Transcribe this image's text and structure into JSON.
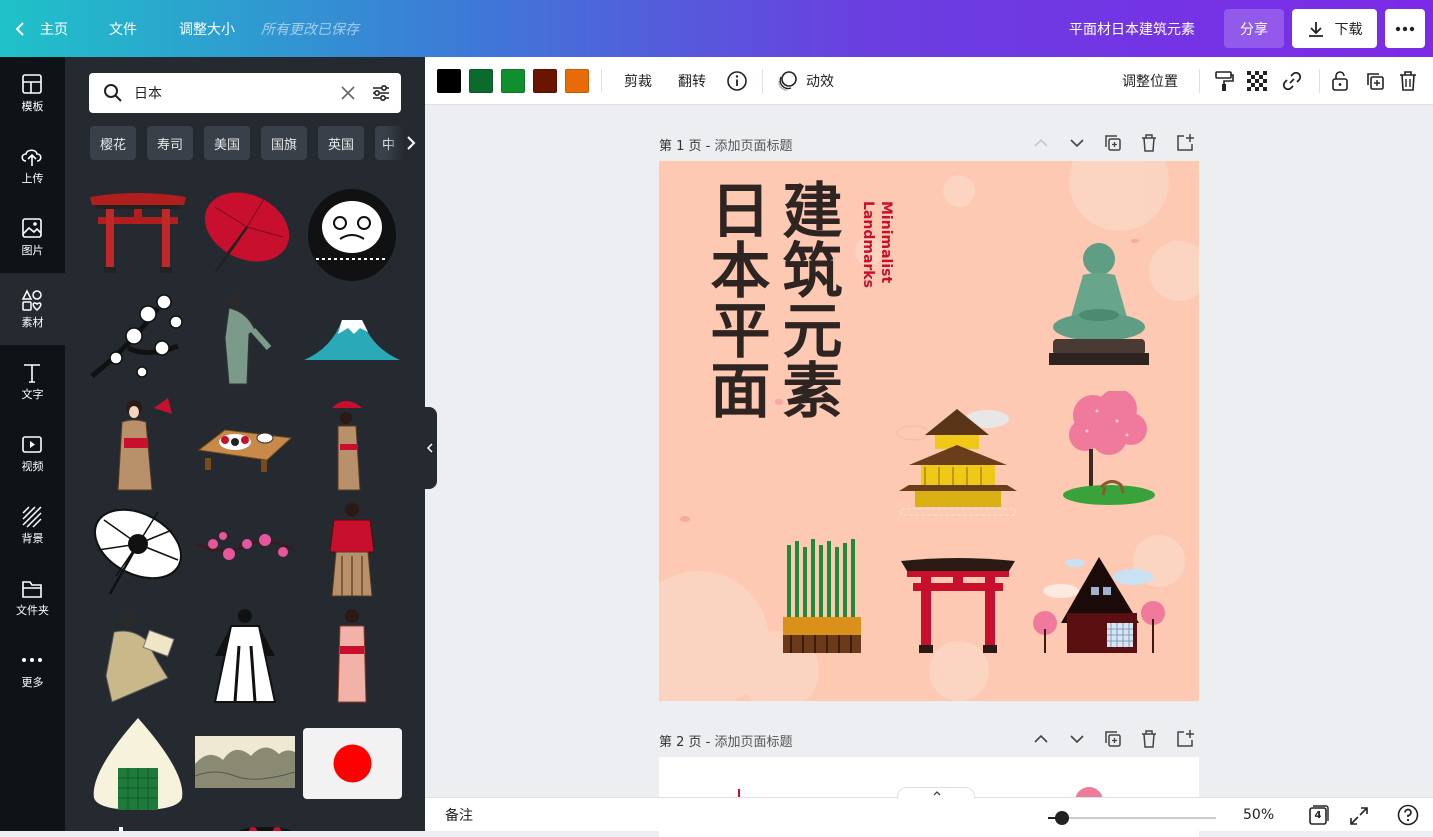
{
  "topbar": {
    "home_label": "主页",
    "file_label": "文件",
    "resize_label": "调整大小",
    "save_status": "所有更改已保存",
    "design_title": "平面材日本建筑元素",
    "share_label": "分享",
    "download_label": "下载"
  },
  "rail": {
    "items": [
      {
        "label": "模板",
        "icon": "template-icon"
      },
      {
        "label": "上传",
        "icon": "upload-icon"
      },
      {
        "label": "图片",
        "icon": "image-icon"
      },
      {
        "label": "素材",
        "icon": "elements-icon"
      },
      {
        "label": "文字",
        "icon": "text-icon"
      },
      {
        "label": "视频",
        "icon": "video-icon"
      },
      {
        "label": "背景",
        "icon": "background-icon"
      },
      {
        "label": "文件夹",
        "icon": "folder-icon"
      },
      {
        "label": "更多",
        "icon": "more-icon"
      }
    ],
    "active_index": 3
  },
  "panel": {
    "search_value": "日本",
    "chips": [
      "樱花",
      "寿司",
      "美国",
      "国旗",
      "英国",
      "中"
    ]
  },
  "toolbar": {
    "colors": [
      "#000000",
      "#0b6b2c",
      "#0f8f2e",
      "#6b1500",
      "#e86b07"
    ],
    "crop_label": "剪裁",
    "flip_label": "翻转",
    "animate_label": "动效",
    "position_label": "调整位置"
  },
  "pages": [
    {
      "prefix": "第 1 页 - ",
      "title": "添加页面标题"
    },
    {
      "prefix": "第 2 页 - ",
      "title": "添加页面标题"
    }
  ],
  "design": {
    "title_col1": "日本平面",
    "title_col2": "建筑元素",
    "subtitle_line1": "Minimalist",
    "subtitle_line2": "Landmarks"
  },
  "bottombar": {
    "notes_label": "备注",
    "zoom_percent": 50,
    "zoom_label": "50%",
    "page_count": "4"
  },
  "colors": {
    "canvas_bg": "#fdc9b3",
    "panel_bg": "#252a31",
    "rail_bg": "#0e1318",
    "accent_red": "#c8102e"
  }
}
